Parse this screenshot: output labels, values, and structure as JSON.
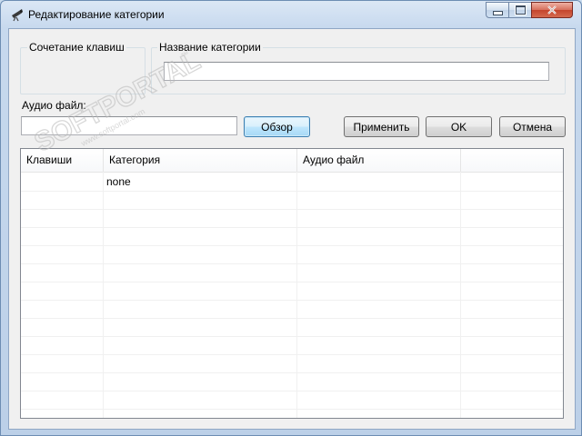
{
  "window": {
    "title": "Редактирование категории",
    "icon": "telescope-icon"
  },
  "form": {
    "hotkey_label": "Сочетание клавиш",
    "category_name_label": "Название категории",
    "category_name_value": "",
    "audio_label": "Аудио файл:",
    "audio_value": "",
    "browse_button": "Обзор",
    "apply_button": "Применить",
    "ok_button": "OK",
    "cancel_button": "Отмена"
  },
  "table": {
    "columns": [
      "Клавиши",
      "Категория",
      "Аудио файл",
      ""
    ],
    "rows": [
      [
        "",
        "none",
        "",
        ""
      ]
    ]
  },
  "watermark": {
    "brand": "SOFTPORTAL",
    "url": "www.softportal.com",
    "tm": "™"
  },
  "colors": {
    "accent": "#3c7fb1",
    "close": "#c4442b"
  }
}
